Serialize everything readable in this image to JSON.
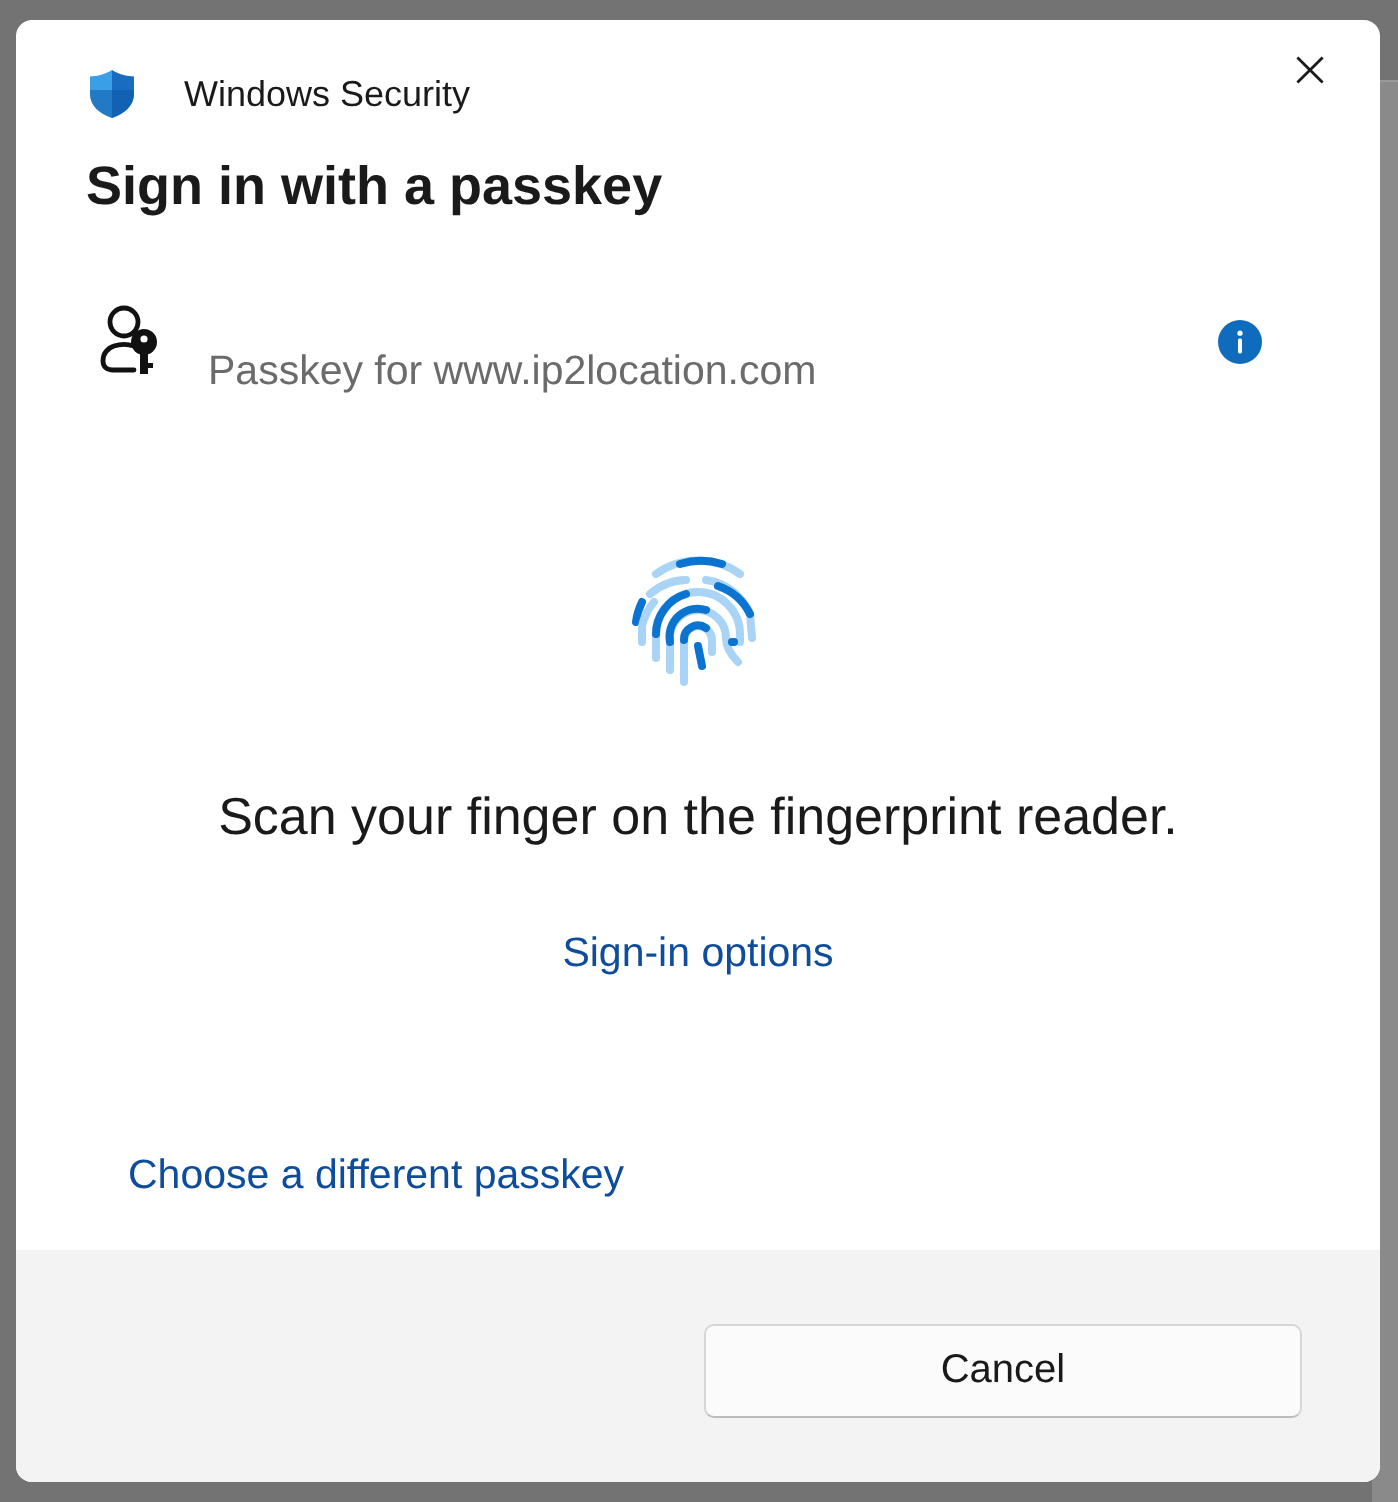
{
  "window": {
    "app_name": "Windows Security",
    "title": "Sign in with a passkey"
  },
  "account": {
    "subtitle": "Passkey for www.ip2location.com"
  },
  "prompt": {
    "message": "Scan your finger on the fingerprint reader.",
    "link": "Sign-in options"
  },
  "alternate_link": "Choose a different passkey",
  "buttons": [
    {
      "label": "Cancel"
    }
  ]
}
